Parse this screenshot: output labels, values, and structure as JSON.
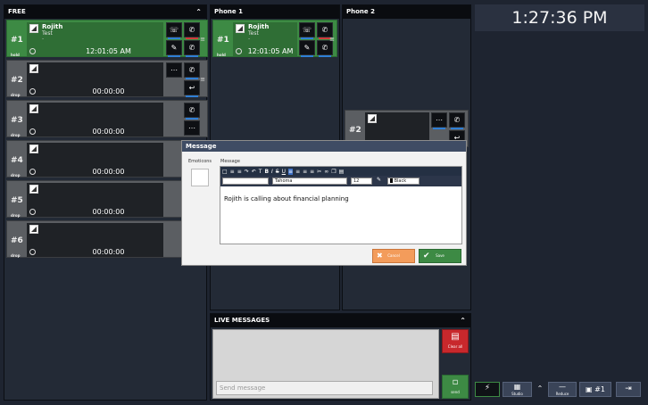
{
  "free": {
    "title": "FREE",
    "lines": [
      {
        "number": "#1",
        "state": "hold",
        "name": "Rojith",
        "sub": "Test",
        "dot": "-",
        "time": "12:01:05 AM"
      },
      {
        "number": "#2",
        "state": "drop",
        "name": "",
        "sub": "",
        "dot": "",
        "time": "00:00:00"
      },
      {
        "number": "#3",
        "state": "drop",
        "name": "",
        "sub": "",
        "dot": "",
        "time": "00:00:00"
      },
      {
        "number": "#4",
        "state": "drop",
        "name": "",
        "sub": "",
        "dot": "",
        "time": "00:00:00"
      },
      {
        "number": "#5",
        "state": "drop",
        "name": "",
        "sub": "",
        "dot": "",
        "time": "00:00:00"
      },
      {
        "number": "#6",
        "state": "drop",
        "name": "",
        "sub": "",
        "dot": "",
        "time": "00:00:00"
      }
    ]
  },
  "phone1": {
    "title": "Phone 1",
    "line": {
      "number": "#1",
      "state": "hold",
      "name": "Rojith",
      "sub": "Test",
      "dot": "-",
      "time": "12:01:05 AM"
    }
  },
  "phone2": {
    "title": "Phone 2",
    "line": {
      "number": "#2",
      "state": "",
      "name": "",
      "sub": "",
      "dot": "",
      "time": ""
    }
  },
  "clock": {
    "time": "1:27:36 PM"
  },
  "live_messages": {
    "title": "LIVE MESSAGES",
    "send_placeholder": "Send message",
    "clear_label": "Clear all",
    "send_label": "send"
  },
  "toolbar": {
    "studio_label": "Studio",
    "reduce_label": "Reduce",
    "monitor_label": "#1"
  },
  "modal": {
    "title": "Message",
    "emoticons_label": "Emoticons",
    "message_label": "Message",
    "font_name": "Tahoma",
    "font_size": "12",
    "font_color": "Black",
    "text": "Rojith is calling about financial planning",
    "cancel_label": "Cancel",
    "save_label": "Save"
  },
  "colors": {
    "active_line": "#3d8a44",
    "idle_line": "#5b5e62",
    "clear": "#c8282c",
    "cancel": "#f39c5b",
    "accent_blue": "#2f7fd6"
  }
}
